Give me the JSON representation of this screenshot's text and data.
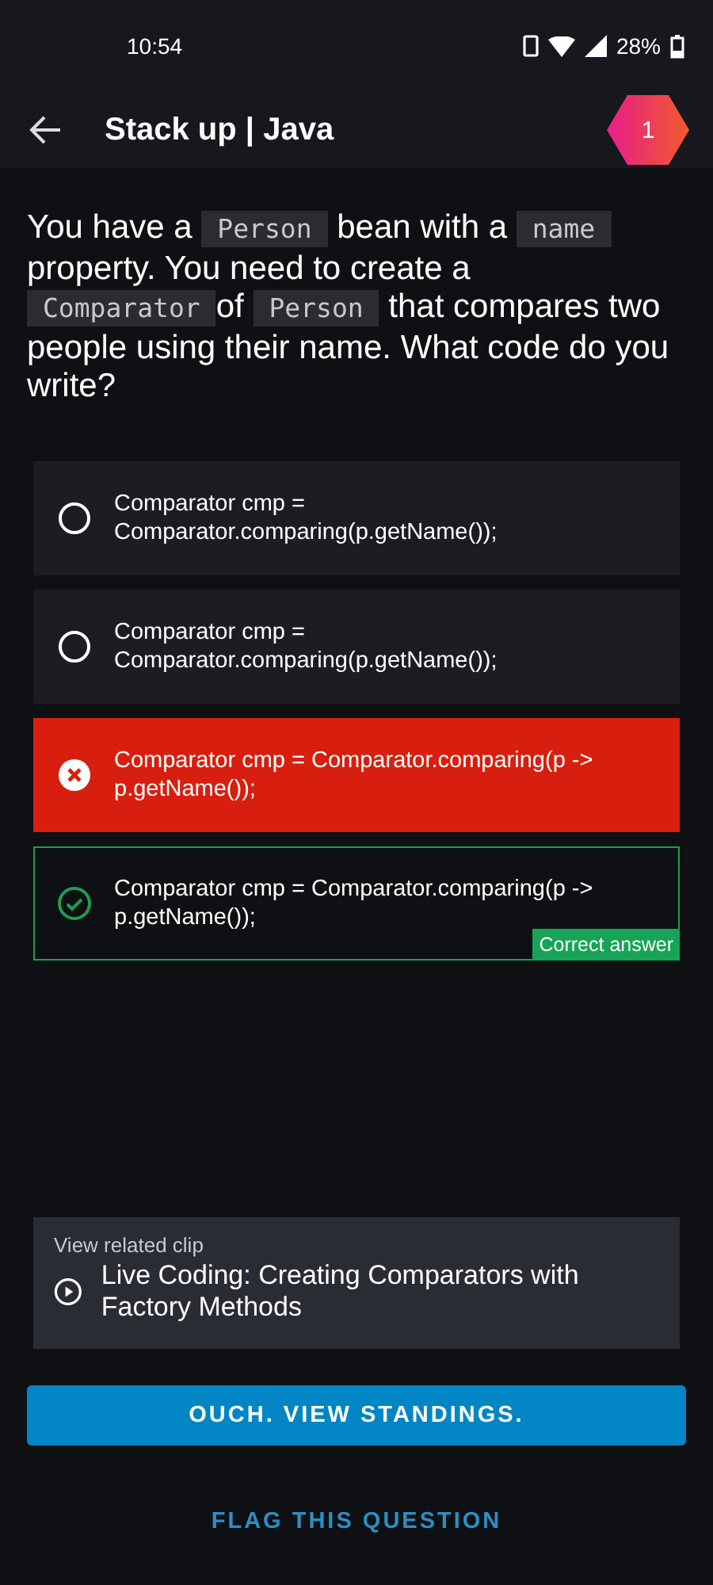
{
  "status_bar": {
    "time": "10:54",
    "battery": "28%"
  },
  "app_bar": {
    "title": "Stack up | Java",
    "badge": "1"
  },
  "question": [
    {
      "kind": "text",
      "text": "You have a "
    },
    {
      "kind": "code",
      "text": "Person"
    },
    {
      "kind": "text",
      "text": " bean with a "
    },
    {
      "kind": "code",
      "text": "name"
    },
    {
      "kind": "text",
      "text": " property. You need to create a "
    },
    {
      "kind": "code",
      "text": "Comparator"
    },
    {
      "kind": "text",
      "text": "of "
    },
    {
      "kind": "code",
      "text": "Person"
    },
    {
      "kind": "text",
      "text": " that compares two people using their name. What code do you write?"
    }
  ],
  "options": [
    {
      "text": "Comparator cmp = Comparator.comparing(p.getName());",
      "kind": "neutral"
    },
    {
      "text": "Comparator cmp = Comparator.comparing(p.getName());",
      "kind": "neutral"
    },
    {
      "text": "Comparator cmp = Comparator.comparing(p -> p.getName());",
      "kind": "wrong"
    },
    {
      "text": "Comparator cmp = Comparator.comparing(p -> p.getName());",
      "kind": "correct",
      "tag": "Correct answer"
    }
  ],
  "related_clip": {
    "label": "View related clip",
    "title": "Live Coding: Creating Comparators with Factory Methods"
  },
  "primary_button": "OUCH. VIEW STANDINGS.",
  "flag_link": "FLAG THIS QUESTION"
}
